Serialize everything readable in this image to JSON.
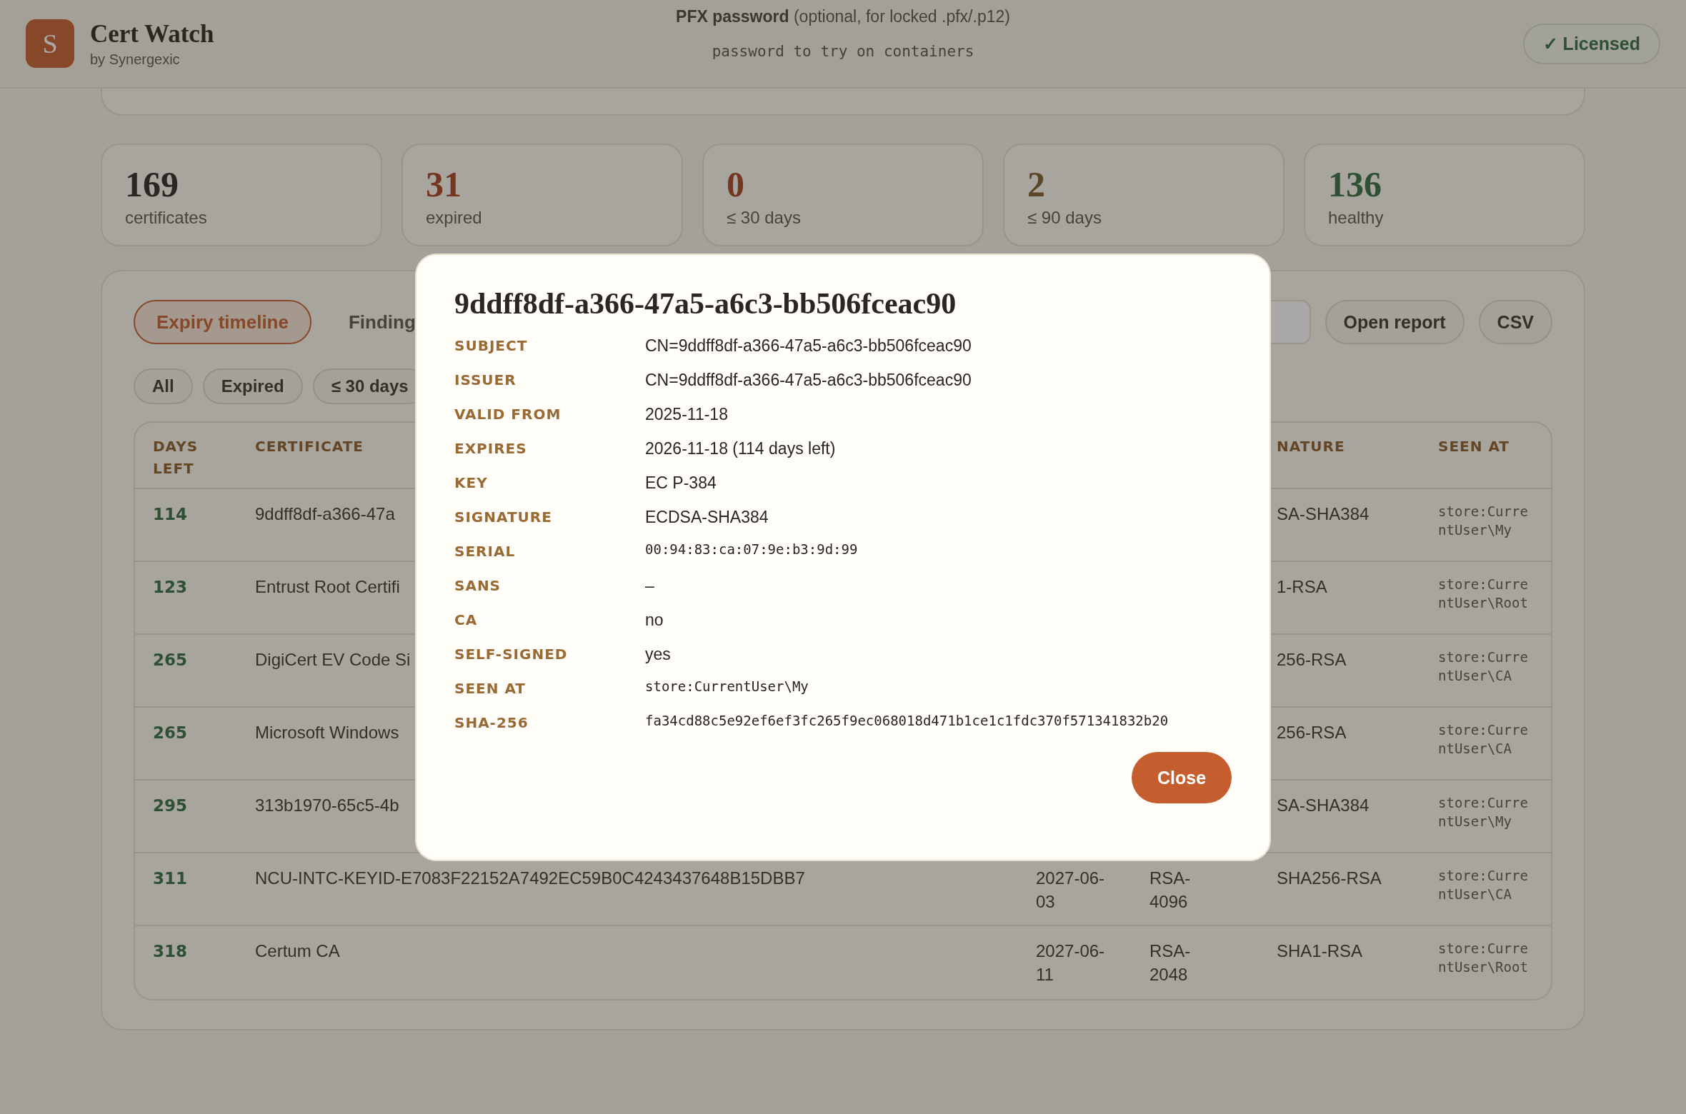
{
  "header": {
    "logo_letter": "S",
    "title": "Cert Watch",
    "subtitle": "by Synergexic",
    "pfx_label": "PFX password",
    "pfx_hint": "(optional, for locked .pfx/.p12)",
    "pfx_placeholder": "password to try on containers",
    "license": "✓ Licensed"
  },
  "stats": [
    {
      "value": "169",
      "label": "certificates",
      "kind": "total"
    },
    {
      "value": "31",
      "label": "expired",
      "kind": "expired"
    },
    {
      "value": "0",
      "label": "≤ 30 days",
      "kind": "soon"
    },
    {
      "value": "2",
      "label": "≤ 90 days",
      "kind": "later"
    },
    {
      "value": "136",
      "label": "healthy",
      "kind": "healthy"
    }
  ],
  "tabs": [
    {
      "label": "Expiry timeline",
      "selected": true
    },
    {
      "label": "Finding",
      "selected": false
    }
  ],
  "actions": [
    "Open report",
    "CSV"
  ],
  "filters": [
    {
      "label": "All",
      "selected": false
    },
    {
      "label": "Expired",
      "selected": false
    },
    {
      "label": "≤ 30 days",
      "selected": false
    }
  ],
  "table": {
    "columns": {
      "days": "DAYS LEFT",
      "certificate": "CERTIFICATE",
      "signature": "NATURE",
      "seen_at": "SEEN AT"
    },
    "rows": [
      {
        "days": "114",
        "certificate": "9ddff8df-a366-47a",
        "signature": "SA-SHA384",
        "seen_at": "store:CurrentUser\\My"
      },
      {
        "days": "123",
        "certificate": "Entrust Root Certifi",
        "signature": "1-RSA",
        "seen_at": "store:CurrentUser\\Root"
      },
      {
        "days": "265",
        "certificate": "DigiCert EV Code Si",
        "signature": "256-RSA",
        "seen_at": "store:CurrentUser\\CA"
      },
      {
        "days": "265",
        "certificate": "Microsoft Windows",
        "signature": "256-RSA",
        "seen_at": "store:CurrentUser\\CA"
      },
      {
        "days": "295",
        "certificate": "313b1970-65c5-4b",
        "signature": "SA-SHA384",
        "seen_at": "store:CurrentUser\\My"
      },
      {
        "days": "311",
        "certificate": "NCU-INTC-KEYID-E7083F22152A7492EC59B0C4243437648B15DBB7",
        "expires": "2027-06-03",
        "key": "RSA-4096",
        "signature": "SHA256-RSA",
        "seen_at": "store:CurrentUser\\CA"
      },
      {
        "days": "318",
        "certificate": "Certum CA",
        "expires": "2027-06-11",
        "key": "RSA-2048",
        "signature": "SHA1-RSA",
        "seen_at": "store:CurrentUser\\Root"
      }
    ]
  },
  "modal": {
    "title": "9ddff8df-a366-47a5-a6c3-bb506fceac90",
    "fields": [
      {
        "label": "SUBJECT",
        "value": "CN=9ddff8df-a366-47a5-a6c3-bb506fceac90",
        "kind": "text"
      },
      {
        "label": "ISSUER",
        "value": "CN=9ddff8df-a366-47a5-a6c3-bb506fceac90",
        "kind": "text"
      },
      {
        "label": "VALID FROM",
        "value": "2025-11-18",
        "kind": "text"
      },
      {
        "label": "EXPIRES",
        "value": "2026-11-18 (114 days left)",
        "kind": "text"
      },
      {
        "label": "KEY",
        "value": "EC P-384",
        "kind": "text"
      },
      {
        "label": "SIGNATURE",
        "value": "ECDSA-SHA384",
        "kind": "text"
      },
      {
        "label": "SERIAL",
        "value": "00:94:83:ca:07:9e:b3:9d:99",
        "kind": "mono"
      },
      {
        "label": "SANS",
        "value": "–",
        "kind": "text"
      },
      {
        "label": "CA",
        "value": "no",
        "kind": "text"
      },
      {
        "label": "SELF-SIGNED",
        "value": "yes",
        "kind": "text"
      },
      {
        "label": "SEEN AT",
        "value": "store:CurrentUser\\My",
        "kind": "mono"
      },
      {
        "label": "SHA-256",
        "value": "fa34cd88c5e92ef6ef3fc265f9ec068018d471b1ce1c1fdc370f571341832b20",
        "kind": "mono"
      }
    ],
    "close": "Close"
  }
}
